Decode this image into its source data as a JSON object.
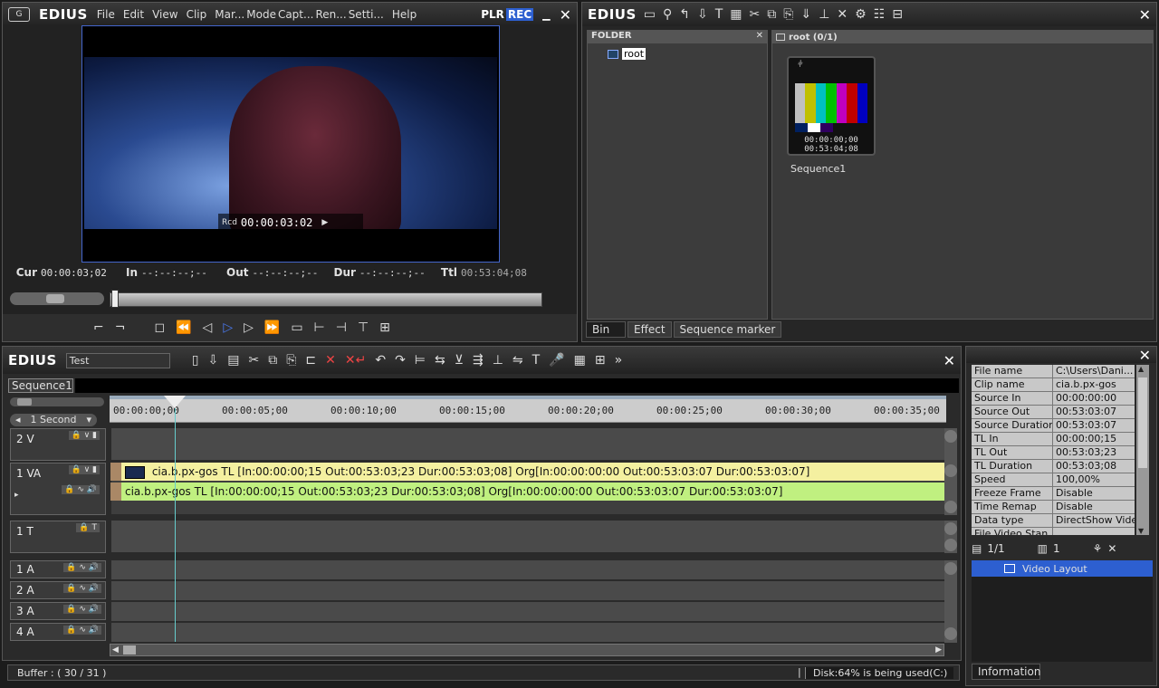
{
  "player": {
    "logo": "EDIUS",
    "menu": [
      "File",
      "Edit",
      "View",
      "Clip",
      "Mar...",
      "Mode",
      "Capt...",
      "Ren...",
      "Setti...",
      "Help"
    ],
    "plr": "PLR",
    "rec": "REC",
    "overlay_prefix": "Rcd",
    "overlay_tc": "00:00:03:02",
    "cur_label": "Cur",
    "cur_value": "00:00:03;02",
    "in_label": "In",
    "in_value": "--:--:--;--",
    "out_label": "Out",
    "out_value": "--:--:--;--",
    "dur_label": "Dur",
    "dur_value": "--:--:--;--",
    "ttl_label": "Ttl",
    "ttl_value": "00:53:04;08"
  },
  "bin": {
    "logo": "EDIUS",
    "folder_header": "FOLDER",
    "root_label": "root",
    "root_header": "root (0/1)",
    "thumb_tc1": "00:00:00;00",
    "thumb_tc2": "00:53:04;08",
    "thumb_name": "Sequence1",
    "tabs": [
      "Bin",
      "Effect",
      "Sequence marker"
    ]
  },
  "timeline": {
    "logo": "EDIUS",
    "project_name": "Test",
    "sequence_tab": "Sequence1",
    "scale": "1 Second",
    "ruler": [
      "00:00:00;00",
      "00:00:05;00",
      "00:00:10;00",
      "00:00:15;00",
      "00:00:20;00",
      "00:00:25;00",
      "00:00:30;00",
      "00:00:35;00"
    ],
    "tracks": [
      "2 V",
      "1 VA",
      "1 T",
      "1 A",
      "2 A",
      "3 A",
      "4 A"
    ],
    "clip_v": "cia.b.px-gos   TL [In:00:00:00;15 Out:00:53:03;23 Dur:00:53:03;08]   Org[In:00:00:00:00 Out:00:53:03:07 Dur:00:53:03:07]",
    "clip_a": "cia.b.px-gos   TL [In:00:00:00;15 Out:00:53:03;23 Dur:00:53:03;08]   Org[In:00:00:00:00 Out:00:53:03:07 Dur:00:53:03:07]"
  },
  "status": {
    "buffer": "Buffer : ( 30 / 31 )",
    "disk": "Disk:64% is being used(C:)"
  },
  "info": {
    "rows": [
      {
        "k": "File name",
        "v": "C:\\Users\\Dani..."
      },
      {
        "k": "Clip name",
        "v": "cia.b.px-gos"
      },
      {
        "k": "Source In",
        "v": "00:00:00:00"
      },
      {
        "k": "Source Out",
        "v": "00:53:03:07"
      },
      {
        "k": "Source Duration",
        "v": "00:53:03:07"
      },
      {
        "k": "TL In",
        "v": "00:00:00;15"
      },
      {
        "k": "TL Out",
        "v": "00:53:03;23"
      },
      {
        "k": "TL Duration",
        "v": "00:53:03;08"
      },
      {
        "k": "Speed",
        "v": "100,00%"
      },
      {
        "k": "Freeze Frame",
        "v": "Disable"
      },
      {
        "k": "Time Remap",
        "v": "Disable"
      },
      {
        "k": "Data type",
        "v": "DirectShow Video"
      },
      {
        "k": "File Video Stan...",
        "v": ""
      }
    ],
    "page": "1/1",
    "count": "1",
    "layout_item": "Video Layout",
    "tab": "Information"
  }
}
